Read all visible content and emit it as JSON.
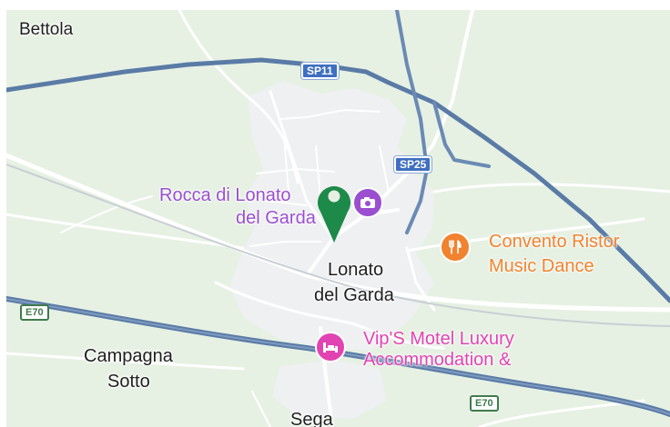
{
  "map": {
    "colors": {
      "land": "#e6f1e3",
      "urban": "#eef0f1",
      "road_major": "#5a7ba6",
      "road_minor": "#ffffff",
      "pin": "#1e8a4a",
      "attraction": "#9a4fd0",
      "restaurant": "#f1822e",
      "hotel": "#e243b2"
    },
    "places": {
      "bettola": "Bettola",
      "lonato_line1": "Lonato",
      "lonato_line2": "del Garda",
      "campagna_line1": "Campagna",
      "campagna_line2": "Sotto",
      "sega": "Sega"
    },
    "shields": {
      "sp11": "SP11",
      "sp25": "SP25",
      "e70_west": "E70",
      "e70_south": "E70"
    },
    "pois": [
      {
        "name_line1": "Rocca di Lonato",
        "name_line2": "del Garda",
        "icon": "camera-icon",
        "category": "attraction"
      },
      {
        "name_line1": "Convento Ristor",
        "name_line2": "Music Dance",
        "icon": "fork-knife-icon",
        "category": "restaurant"
      },
      {
        "name_line1": "Vip'S Motel Luxury",
        "name_line2": "Accommodation &",
        "icon": "bed-icon",
        "category": "hotel"
      }
    ],
    "pin": {
      "icon": "map-pin-icon"
    }
  }
}
